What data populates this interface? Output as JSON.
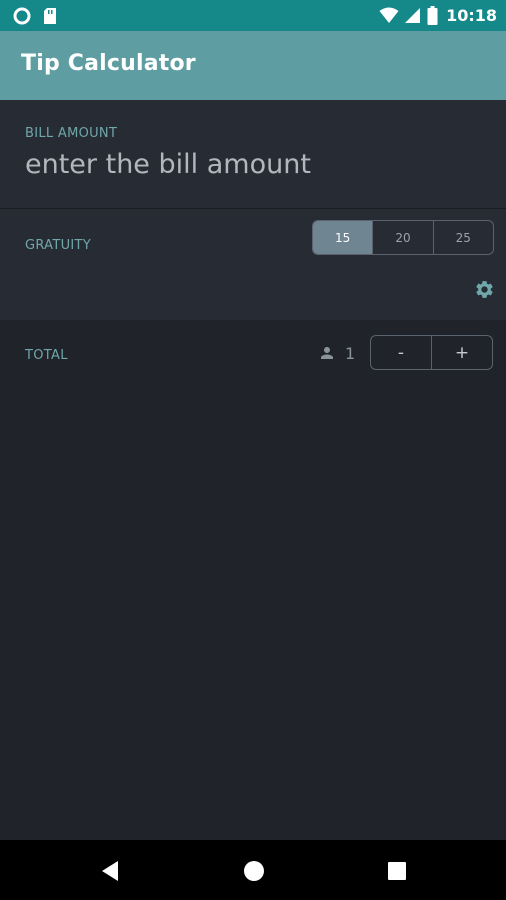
{
  "status_bar": {
    "time": "10:18",
    "left_icons": [
      "circle-notification-icon",
      "sd-card-icon"
    ],
    "right_icons": [
      "wifi-icon",
      "cellular-signal-icon",
      "battery-icon"
    ]
  },
  "app_bar": {
    "title": "Tip Calculator"
  },
  "bill": {
    "label": "BILL AMOUNT",
    "value": "",
    "placeholder": "enter the bill amount"
  },
  "gratuity": {
    "label": "GRATUITY",
    "options": [
      "15",
      "20",
      "25"
    ],
    "selected": "15",
    "settings_icon": "gear-icon"
  },
  "total": {
    "label": "TOTAL",
    "people_icon": "person-icon",
    "people_count": "1",
    "decrement_label": "-",
    "increment_label": "+"
  },
  "nav_bar": {
    "icons": [
      "back-icon",
      "home-icon",
      "recents-icon"
    ]
  },
  "colors": {
    "status_bar": "#15888a",
    "app_bar": "#5e9ea2",
    "section_bg": "#272c34",
    "page_bg": "#20232a",
    "label_accent": "#6fa7ab",
    "selected_tip": "#6f8592"
  }
}
